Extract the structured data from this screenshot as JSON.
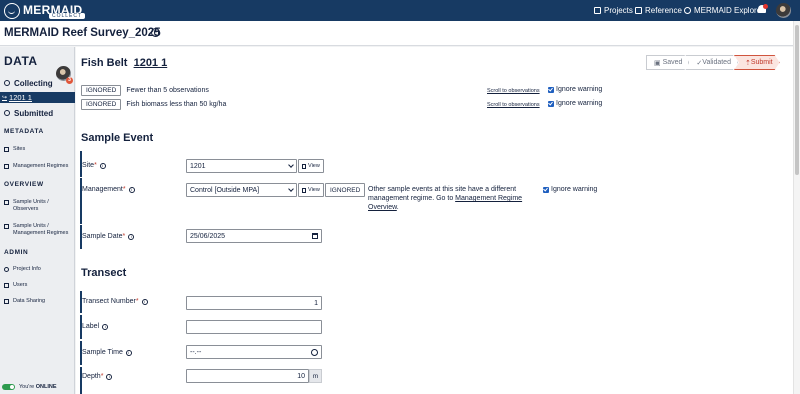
{
  "topbar": {
    "logo_text": "MERMAID",
    "logo_sub": "COLLECT",
    "nav": [
      "Projects",
      "Reference",
      "MERMAID Explore"
    ]
  },
  "project_title": "MERMAID Reef Survey_2025",
  "sidebar": {
    "heading": "DATA",
    "badge": "3",
    "collecting": "Collecting",
    "record": "1201 1",
    "submitted": "Submitted",
    "sections": {
      "metadata": "METADATA",
      "overview": "OVERVIEW",
      "admin": "ADMIN"
    },
    "metadata_links": [
      "Sites",
      "Management Regimes"
    ],
    "overview_links": [
      "Sample Units / Observers",
      "Sample Units / Management Regimes"
    ],
    "admin_links": [
      "Project Info",
      "Users",
      "Data Sharing"
    ],
    "online_prefix": "You're",
    "online_status": "ONLINE"
  },
  "header": {
    "title_prefix": "Fish Belt",
    "title_record": "1201 1",
    "status_saved": "Saved",
    "status_validated": "Validated",
    "status_submit": "Submit"
  },
  "warnings": [
    {
      "badge": "IGNORED",
      "text": "Fewer than 5 observations",
      "link": "Scroll to observations",
      "ignore": "Ignore warning"
    },
    {
      "badge": "IGNORED",
      "text": "Fish biomass less than 50 kg/ha",
      "link": "Scroll to observations",
      "ignore": "Ignore warning"
    }
  ],
  "sample_event": {
    "heading": "Sample Event",
    "site_label": "Site",
    "site_value": "1201",
    "view": "View",
    "management_label": "Management",
    "management_value": "Control [Outside MPA]",
    "management_badge": "IGNORED",
    "management_msg_pre": "Other sample events at this site have a different management regime. Go to ",
    "management_msg_link": "Management Regime Overview",
    "management_msg_post": ".",
    "management_ignore": "Ignore warning",
    "date_label": "Sample Date",
    "date_value": "25/06/2025"
  },
  "transect": {
    "heading": "Transect",
    "number_label": "Transect Number",
    "number_value": "1",
    "label_label": "Label",
    "label_value": "",
    "time_label": "Sample Time",
    "time_value": "--.--",
    "depth_label": "Depth",
    "depth_value": "10",
    "depth_unit": "m"
  }
}
